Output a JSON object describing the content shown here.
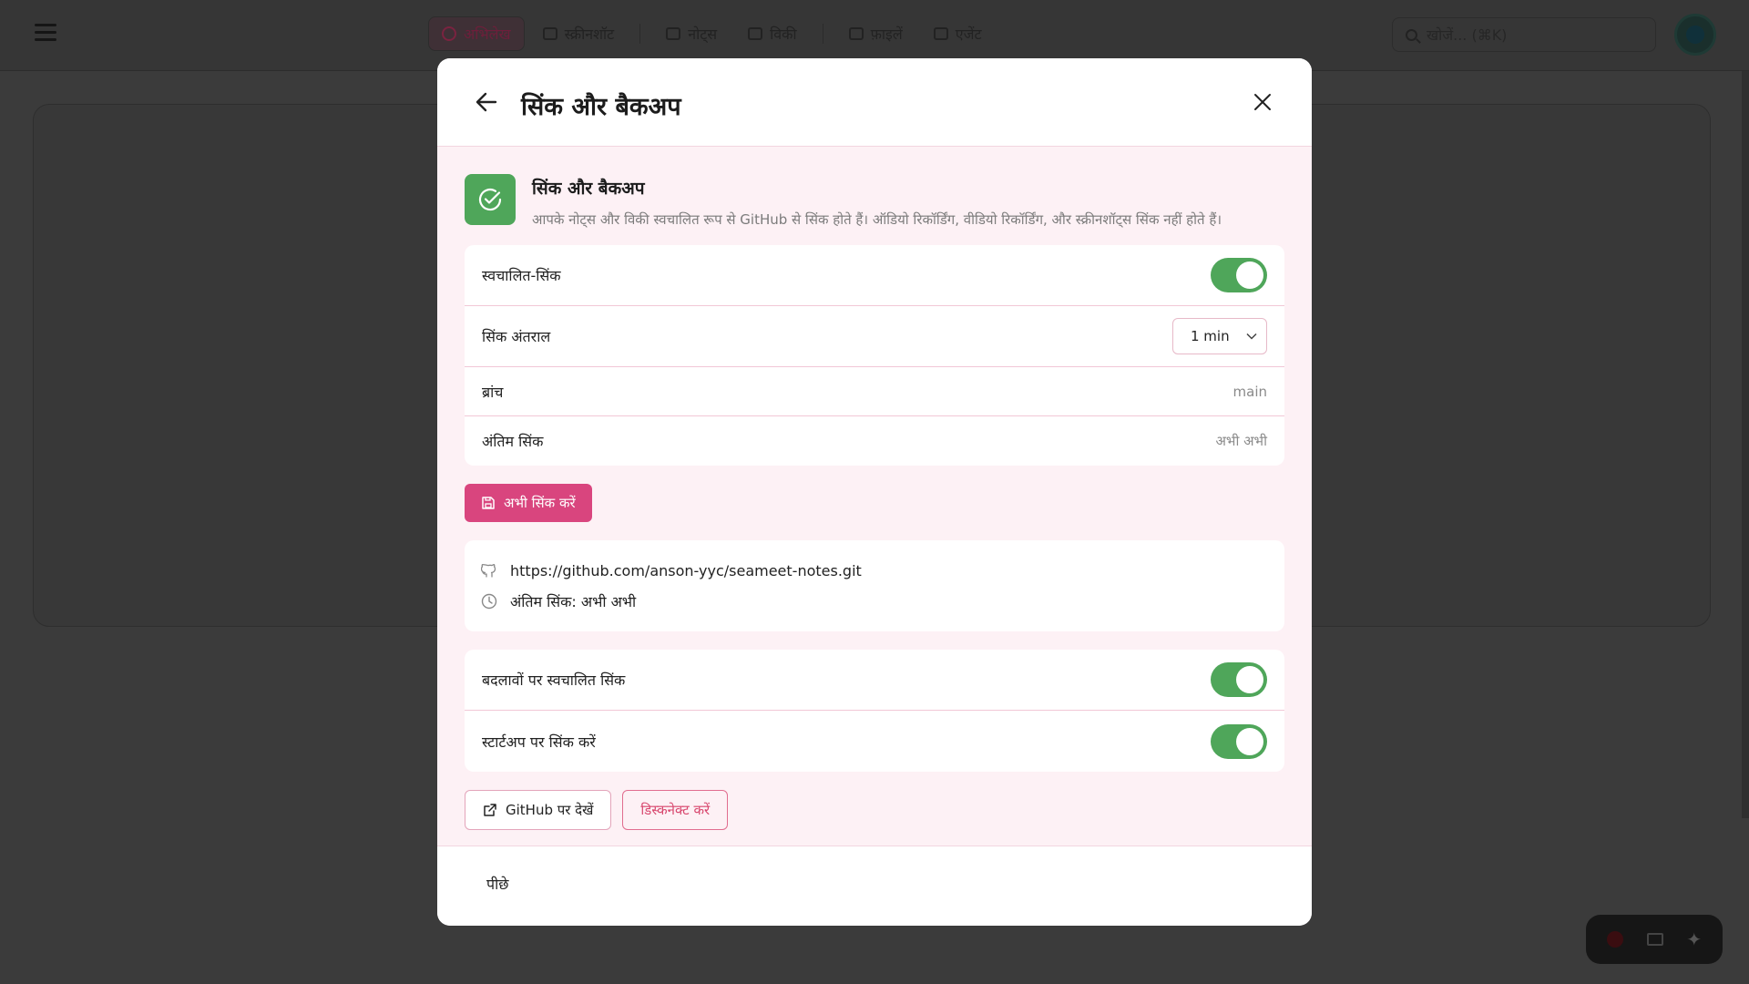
{
  "app": {
    "nav_tabs": [
      {
        "label": "अभिलेख",
        "icon": "record-icon",
        "active": true
      },
      {
        "label": "स्क्रीनशॉट",
        "icon": "screenshot-icon"
      },
      {
        "label": "नोट्स",
        "icon": "notes-icon"
      },
      {
        "label": "विकी",
        "icon": "wiki-icon"
      },
      {
        "label": "फ़ाइलें",
        "icon": "files-icon"
      },
      {
        "label": "एजेंट",
        "icon": "agent-icon"
      }
    ],
    "search_placeholder": "खोजें... (⌘K)"
  },
  "modal": {
    "title": "सिंक और बैकअप",
    "intro": {
      "title": "सिंक और बैकअप",
      "description": "आपके नोट्स और विकी स्वचालित रूप से GitHub से सिंक होते हैं। ऑडियो रिकॉर्डिंग, वीडियो रिकॉर्डिंग, और स्क्रीनशॉट्स सिंक नहीं होते हैं।"
    },
    "settings": {
      "auto_sync_label": "स्वचालित-सिंक",
      "auto_sync_on": true,
      "interval_label": "सिंक अंतराल",
      "interval_value": "1 min",
      "branch_label": "ब्रांच",
      "branch_value": "main",
      "last_sync_label": "अंतिम सिंक",
      "last_sync_value": "अभी अभी"
    },
    "sync_now_label": "अभी सिंक करें",
    "repo": {
      "url": "https://github.com/anson-yyc/seameet-notes.git",
      "last_sync_text": "अंतिम सिंक: अभी अभी"
    },
    "options": {
      "sync_on_changes_label": "बदलावों पर स्वचालित सिंक",
      "sync_on_changes_on": true,
      "sync_on_startup_label": "स्टार्टअप पर सिंक करें",
      "sync_on_startup_on": true
    },
    "view_github_label": "GitHub पर देखें",
    "disconnect_label": "डिस्कनेक्ट करें",
    "footer_back_label": "पीछे"
  },
  "colors": {
    "accent": "#d9457e",
    "toggle_on": "#4fa65a",
    "danger": "#d8476e"
  }
}
